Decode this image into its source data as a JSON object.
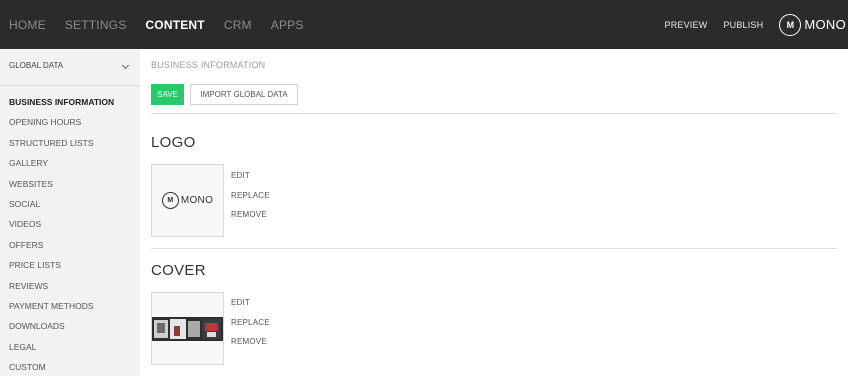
{
  "topbar": {
    "nav": [
      "HOME",
      "SETTINGS",
      "CONTENT",
      "CRM",
      "APPS"
    ],
    "active_nav": "CONTENT",
    "preview": "PREVIEW",
    "publish": "PUBLISH",
    "brand_mark": "M",
    "brand_name": "MONO"
  },
  "sidebar": {
    "select_value": "GLOBAL DATA",
    "items": [
      "BUSINESS INFORMATION",
      "OPENING HOURS",
      "STRUCTURED LISTS",
      "GALLERY",
      "WEBSITES",
      "SOCIAL",
      "VIDEOS",
      "OFFERS",
      "PRICE LISTS",
      "REVIEWS",
      "PAYMENT METHODS",
      "DOWNLOADS",
      "LEGAL",
      "CUSTOM"
    ],
    "active_item": "BUSINESS INFORMATION"
  },
  "main": {
    "breadcrumb": "BUSINESS INFORMATION",
    "save_label": "SAVE",
    "import_label": "IMPORT GLOBAL DATA",
    "logo": {
      "title": "LOGO",
      "mark": "M",
      "name": "MONO",
      "actions": [
        "EDIT",
        "REPLACE",
        "REMOVE"
      ]
    },
    "cover": {
      "title": "COVER",
      "actions": [
        "EDIT",
        "REPLACE",
        "REMOVE"
      ]
    }
  },
  "colors": {
    "topbar_bg": "#2b2b2b",
    "sidebar_bg": "#f2f2f2",
    "save_green": "#27c96b"
  }
}
